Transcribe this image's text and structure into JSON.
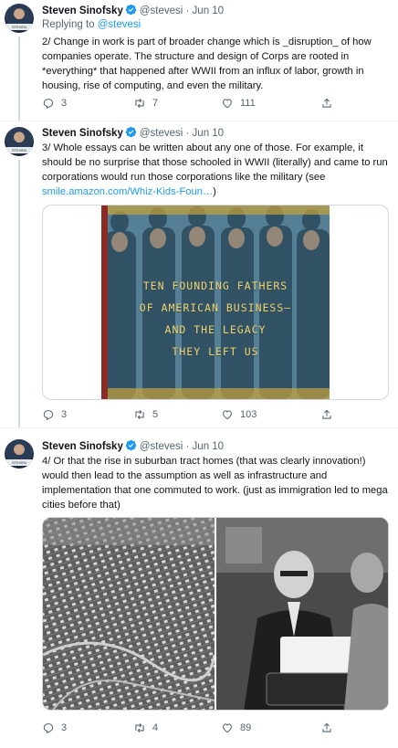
{
  "tweets": [
    {
      "author_name": "Steven Sinofsky",
      "handle": "@stevesi",
      "date": "Jun 10",
      "replying_prefix": "Replying to",
      "replying_handle": "@stevesi",
      "text": "2/ Change in work is part of broader change which is _disruption_ of how companies operate. The structure and design of Corps are rooted in *everything* that happened after WWII from an influx of labor, growth in housing, rise of computing, and even the military.",
      "replies": "3",
      "retweets": "7",
      "likes": "111"
    },
    {
      "author_name": "Steven Sinofsky",
      "handle": "@stevesi",
      "date": "Jun 10",
      "text": "3/ Whole essays can be written about any one of those. For example, it should be no surprise that those schooled in WWII (literally) and came to run corporations would run those corporations like the military (see ",
      "link": "smile.amazon.com/Whiz-Kids-Foun…",
      "text_end": ")",
      "book_title_lines": [
        "TEN FOUNDING FATHERS",
        "OF AMERICAN BUSINESS—",
        "AND THE LEGACY",
        "THEY LEFT US"
      ],
      "replies": "3",
      "retweets": "5",
      "likes": "103"
    },
    {
      "author_name": "Steven Sinofsky",
      "handle": "@stevesi",
      "date": "Jun 10",
      "text": "4/ Or that the rise in suburban tract homes (that was clearly innovation!) would then lead to the assumption as well as infrastructure and implementation that one commuted to work. (just as immigration led to mega cities before that)",
      "replies": "3",
      "retweets": "4",
      "likes": "89"
    }
  ],
  "avatar_tag": "STEVEN",
  "icons": [
    "verified-badge-icon",
    "reply-icon",
    "retweet-icon",
    "like-icon",
    "share-icon"
  ],
  "colors": {
    "accent": "#1d9bf0",
    "muted": "#536471",
    "text": "#0f1419",
    "border": "#cfd9de"
  }
}
